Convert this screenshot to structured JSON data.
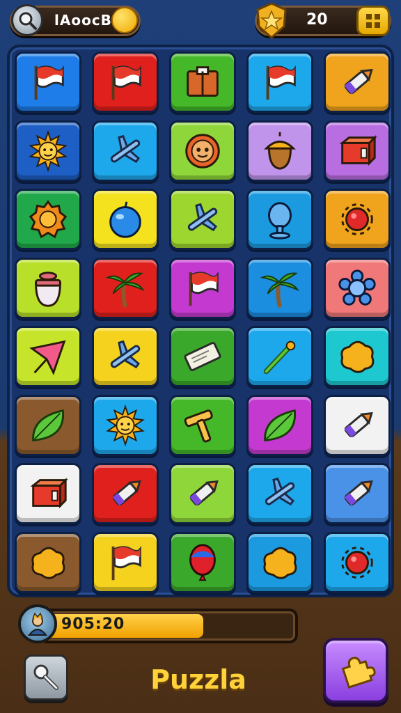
{
  "header": {
    "left_label": "lAoocB",
    "score": "20",
    "search_icon": "magnifier-icon",
    "coin_icon": "gold-coin-icon",
    "badge_icon": "star-shield-icon",
    "grid_icon": "grid-menu-icon"
  },
  "board": {
    "rows": [
      [
        {
          "icon": "flag-icon",
          "color": "#1e7de8"
        },
        {
          "icon": "flag-icon",
          "color": "#e0201c"
        },
        {
          "icon": "crate-icon",
          "color": "#45b82a"
        },
        {
          "icon": "flag-icon",
          "color": "#1ea8ec"
        },
        {
          "icon": "crayon-icon",
          "color": "#f0a31c"
        }
      ],
      [
        {
          "icon": "sun-icon",
          "color": "#1d5fc4"
        },
        {
          "icon": "plane-icon",
          "color": "#1ea8ec"
        },
        {
          "icon": "button-icon",
          "color": "#8fd63a"
        },
        {
          "icon": "acorn-icon",
          "color": "#c094ea"
        },
        {
          "icon": "box-icon",
          "color": "#b86ee0"
        }
      ],
      [
        {
          "icon": "gear-icon",
          "color": "#21a84a"
        },
        {
          "icon": "berry-icon",
          "color": "#f4e21e"
        },
        {
          "icon": "plane-icon",
          "color": "#9ed630"
        },
        {
          "icon": "lamp-icon",
          "color": "#1c9ae0"
        },
        {
          "icon": "bug-icon",
          "color": "#f0a31c"
        }
      ],
      [
        {
          "icon": "vase-icon",
          "color": "#b8e02a"
        },
        {
          "icon": "palm-tree-icon",
          "color": "#e0201c"
        },
        {
          "icon": "flag-icon",
          "color": "#c43ad0"
        },
        {
          "icon": "palm-tree-icon",
          "color": "#1c8ee0"
        },
        {
          "icon": "flower-icon",
          "color": "#f07878"
        }
      ],
      [
        {
          "icon": "kite-icon",
          "color": "#c6e42a"
        },
        {
          "icon": "plane-icon",
          "color": "#f4d21e"
        },
        {
          "icon": "eraser-icon",
          "color": "#3aa82a"
        },
        {
          "icon": "arrow-icon",
          "color": "#1ea8ec"
        },
        {
          "icon": "blob-icon",
          "color": "#1ec8d0"
        }
      ],
      [
        {
          "icon": "leaf-icon",
          "color": "#8a5a2e"
        },
        {
          "icon": "sun-icon",
          "color": "#1ea8ec"
        },
        {
          "icon": "hammer-icon",
          "color": "#45b82a"
        },
        {
          "icon": "leaf-icon",
          "color": "#c43ad0"
        },
        {
          "icon": "crayon-icon",
          "color": "#f2f2f2"
        }
      ],
      [
        {
          "icon": "box-icon",
          "color": "#f2f2f2"
        },
        {
          "icon": "crayon-icon",
          "color": "#e0201c"
        },
        {
          "icon": "crayon-icon",
          "color": "#8fd63a"
        },
        {
          "icon": "plane-icon",
          "color": "#1ea8ec"
        },
        {
          "icon": "crayon-icon",
          "color": "#4a92e8"
        }
      ],
      [
        {
          "icon": "blob-icon",
          "color": "#8a5a2e"
        },
        {
          "icon": "flag-icon",
          "color": "#f4d21e"
        },
        {
          "icon": "balloon-icon",
          "color": "#3aa82a"
        },
        {
          "icon": "blob-icon",
          "color": "#1c9ae0"
        },
        {
          "icon": "bug-icon",
          "color": "#1ea8ec"
        }
      ]
    ]
  },
  "footer": {
    "timer_text": "905:20",
    "progress_fraction": 0.64,
    "avatar_icon": "character-avatar-icon",
    "key_icon": "key-icon",
    "title": "Puzzla",
    "action_icon": "puzzle-piece-icon"
  }
}
